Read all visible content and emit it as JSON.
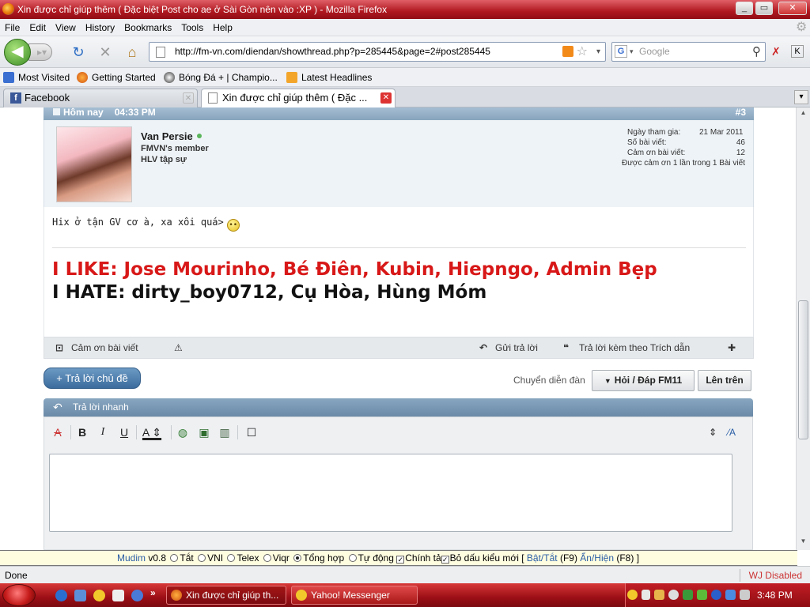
{
  "window": {
    "title": "Xin được chỉ giúp thêm ( Đặc biệt Post cho ae ở Sài Gòn nên vào :XP ) - Mozilla Firefox"
  },
  "menu": [
    "File",
    "Edit",
    "View",
    "History",
    "Bookmarks",
    "Tools",
    "Help"
  ],
  "nav": {
    "url": "http://fm-vn.com/diendan/showthread.php?p=285445&page=2#post285445",
    "search_placeholder": "Google"
  },
  "bookmarks": [
    "Most Visited",
    "Getting Started",
    "Bóng Đá + | Champio...",
    "Latest Headlines"
  ],
  "tabs": [
    {
      "label": "Facebook",
      "active": false
    },
    {
      "label": "Xin được chỉ giúp thêm ( Đặc ...",
      "active": true
    }
  ],
  "post": {
    "date": "Hôm nay",
    "time": "04:33 PM",
    "number": "#3",
    "user": {
      "name": "Van Persie",
      "title1": "FMVN's member",
      "title2": "HLV tập sự"
    },
    "stats": {
      "join_label": "Ngày tham gia:",
      "join_value": "21 Mar 2011",
      "posts_label": "Số bài viết:",
      "posts_value": "46",
      "thanks_label": "Cảm ơn bài viết:",
      "thanks_value": "12",
      "thanked": "Được cảm ơn 1 lần trong 1 Bài viết"
    },
    "message": "Hix ở tận GV cơ à, xa xôi quá>",
    "signature_like": "I LIKE: Jose Mourinho, Bé Điên, Kubin, Hiepngo, Admin Bẹp",
    "signature_hate": "I HATE: dirty_boy0712, Cụ Hòa, Hùng Móm",
    "footer": {
      "thanks": "Cảm ơn bài viết",
      "reply": "Gửi trả lời",
      "quote": "Trả lời kèm theo Trích dẫn"
    }
  },
  "thread": {
    "reply_button": "+ Trả lời chủ đề",
    "forum_jump": "Chuyển diễn đàn",
    "forum_name": "Hỏi / Đáp FM11",
    "top": "Lên trên"
  },
  "quick_reply": {
    "title": "Trả lời nhanh"
  },
  "mudim": {
    "name": "Mudim",
    "version": "v0.8",
    "opt_off": "Tắt",
    "opt_vni": "VNI",
    "opt_telex": "Telex",
    "opt_viqr": "Viqr",
    "opt_combo": "Tổng hợp",
    "opt_auto": "Tự động",
    "check_spell": "Chính tả",
    "check_accent": "Bỏ dấu kiểu mới",
    "bracket_open": "[",
    "toggle": "Bật/Tắt",
    "toggle_key": "(F9)",
    "hide": "Ẩn/Hiện",
    "hide_key": "(F8)",
    "bracket_close": "]",
    "selected": "Tổng hợp"
  },
  "status": {
    "left": "Done",
    "right": "WJ Disabled"
  },
  "taskbar": {
    "tasks": [
      "Xin được chỉ giúp th...",
      "Yahoo! Messenger"
    ],
    "clock": "3:48 PM"
  },
  "colors": {
    "like": "#d81818",
    "hate": "#111111",
    "post_header": "#86a3bc",
    "taskbar": "#b01820"
  }
}
